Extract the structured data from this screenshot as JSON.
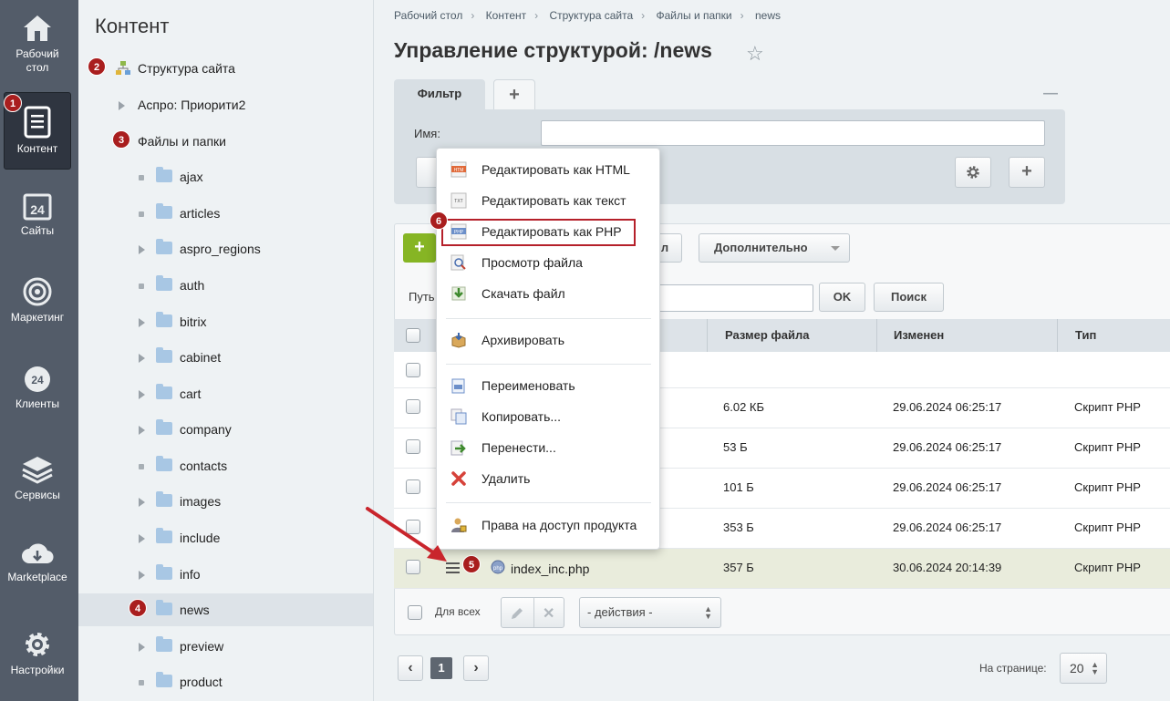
{
  "rail": [
    {
      "id": "desktop",
      "label1": "Рабочий",
      "label2": "стол"
    },
    {
      "id": "content",
      "label1": "Контент",
      "label2": ""
    },
    {
      "id": "sites",
      "label1": "Сайты",
      "label2": ""
    },
    {
      "id": "marketing",
      "label1": "Маркетинг",
      "label2": ""
    },
    {
      "id": "clients",
      "label1": "Клиенты",
      "label2": ""
    },
    {
      "id": "services",
      "label1": "Сервисы",
      "label2": ""
    },
    {
      "id": "marketplace",
      "label1": "Marketplace",
      "label2": ""
    },
    {
      "id": "settings",
      "label1": "Настройки",
      "label2": ""
    }
  ],
  "tree": {
    "title": "Контент",
    "site_structure": "Структура сайта",
    "aspro": "Аспро: Приорити2",
    "files": "Файлы и папки",
    "folders": [
      "ajax",
      "articles",
      "aspro_regions",
      "auth",
      "bitrix",
      "cabinet",
      "cart",
      "company",
      "contacts",
      "images",
      "include",
      "info",
      "news",
      "preview",
      "product"
    ]
  },
  "badges": [
    "1",
    "2",
    "3",
    "4",
    "5",
    "6"
  ],
  "breadcrumb": [
    "Рабочий стол",
    "Контент",
    "Структура сайта",
    "Файлы и папки",
    "news"
  ],
  "page_title": "Управление структурой: /news",
  "filter": {
    "tab": "Фильтр",
    "add_tab": "+",
    "collapse": "—",
    "name_label": "Имя:",
    "name_value": ""
  },
  "toolbar": {
    "add": "+",
    "partial_button": "л",
    "more": "Дополнительно"
  },
  "path": {
    "label": "Путь",
    "ok": "OK",
    "search": "Поиск"
  },
  "grid": {
    "headers": {
      "size": "Размер файла",
      "modified": "Изменен",
      "type": "Тип"
    },
    "rows": [
      {
        "name": "",
        "size": "",
        "modified": "",
        "type": ""
      },
      {
        "name": "",
        "size": "6.02 КБ",
        "modified": "29.06.2024 06:25:17",
        "type": "Скрипт PHP"
      },
      {
        "name": "",
        "size": "53 Б",
        "modified": "29.06.2024 06:25:17",
        "type": "Скрипт PHP"
      },
      {
        "name": "",
        "size": "101 Б",
        "modified": "29.06.2024 06:25:17",
        "type": "Скрипт PHP"
      },
      {
        "name": "",
        "size": "353 Б",
        "modified": "29.06.2024 06:25:17",
        "type": "Скрипт PHP"
      },
      {
        "name": "index_inc.php",
        "size": "357 Б",
        "modified": "30.06.2024 20:14:39",
        "type": "Скрипт PHP"
      }
    ]
  },
  "footer": {
    "for_all": "Для всех",
    "actions": "- действия -",
    "page": "1",
    "per_page_label": "На странице:",
    "per_page": "20"
  },
  "menu": {
    "edit_html": "Редактировать как HTML",
    "edit_text": "Редактировать как текст",
    "edit_php": "Редактировать как PHP",
    "view": "Просмотр файла",
    "download": "Скачать файл",
    "archive": "Архивировать",
    "rename": "Переименовать",
    "copy": "Копировать...",
    "move": "Перенести...",
    "delete": "Удалить",
    "access": "Права на доступ продукта"
  },
  "icon_badges": {
    "html": "HTM",
    "txt": "TXT",
    "php": "PHP"
  },
  "colors": {
    "rail": "#535c69",
    "accent_red": "#a91e1e",
    "add_green": "#86b524"
  }
}
